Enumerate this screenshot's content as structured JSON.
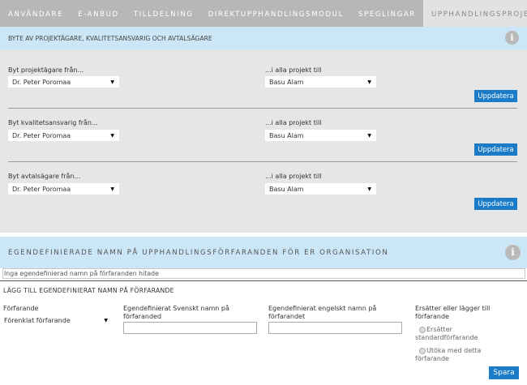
{
  "nav": {
    "tabs": [
      "ANVÄNDARE",
      "E-ANBUD",
      "TILLDELNING",
      "DIREKTUPPHANDLINGSMODUL",
      "SPEGLINGAR"
    ],
    "active_tab": "UPPHANDLINGSPROJEKT"
  },
  "section1": {
    "title": "BYTE AV PROJEKTÄGARE, KVALITETSANSVARIG OCH AVTALSÄGARE",
    "info_icon": "info-icon",
    "rows": [
      {
        "from_label": "Byt projektägare från...",
        "from_value": "Dr. Peter Poromaa",
        "to_label": "...i alla projekt till",
        "to_value": "Basu Alam",
        "button": "Uppdatera"
      },
      {
        "from_label": "Byt kvalitetsansvarig från...",
        "from_value": "Dr. Peter Poromaa",
        "to_label": "...i alla projekt till",
        "to_value": "Basu Alam",
        "button": "Uppdatera"
      },
      {
        "from_label": "Byt avtalsägare från...",
        "from_value": "Dr. Peter Poromaa",
        "to_label": "...i alla projekt till",
        "to_value": "Basu Alam",
        "button": "Uppdatera"
      }
    ]
  },
  "section2": {
    "title": "EGENDEFINIERADE NAMN PÅ UPPHANDLINGSFÖRFARANDEN FÖR ER ORGANISATION",
    "empty_message": "Inga egendefinierad namn på förfaranden hitade",
    "add": {
      "title": "LÄGG TILL EGENDEFINIERAT NAMN PÅ FÖRFARANDE",
      "procedure_label": "Förfarande",
      "procedure_value": "Förenklat förfarande",
      "swedish_label_line1": "Egendefinierat Svenskt namn på",
      "swedish_label_line2": "förfaranded",
      "swedish_value": "",
      "english_label_line1": "Egendefinierat engelskt namn på",
      "english_label_line2": "förfarandet",
      "english_value": "",
      "mode_label_line1": "Ersätter eller lägger till",
      "mode_label_line2": "förfarande",
      "radio1_line1": "Ersätter",
      "radio1_line2": "standardförfarande",
      "radio2_line1": "Utöka med detta",
      "radio2_line2": "förfarande",
      "save_button": "Spara"
    }
  },
  "colors": {
    "nav_bg": "#b7b7b7",
    "band_bg": "#cbe6f6",
    "panel_bg": "#e6e6e6",
    "button_bg": "#1a7bc9"
  }
}
